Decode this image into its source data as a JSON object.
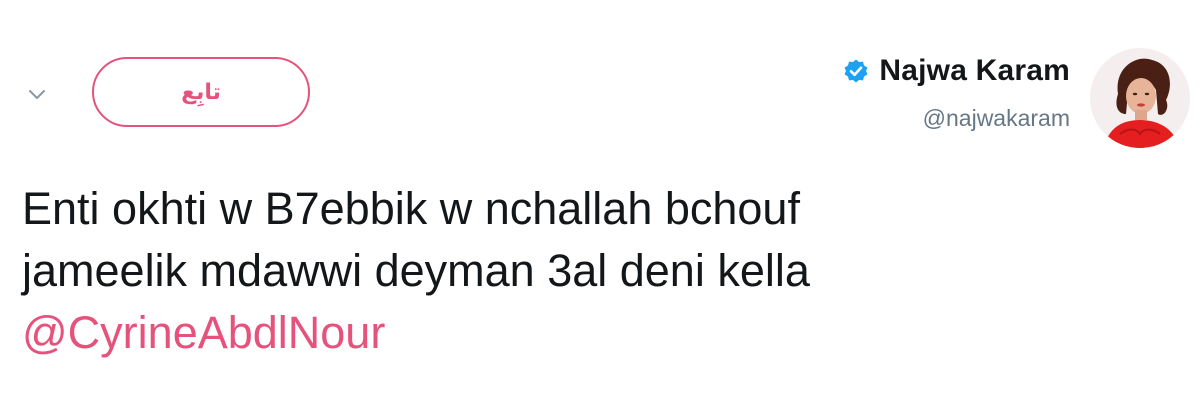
{
  "header": {
    "follow_label": "تابِع",
    "display_name": "Najwa Karam",
    "handle": "@najwakaram",
    "verified": true,
    "more_icon": "chevron-down-icon",
    "verified_icon": "verified-badge-icon"
  },
  "tweet": {
    "line1": "Enti okhti w B7ebbik w nchallah bchouf",
    "line2": "jameelik mdawwi deyman 3al deni kella",
    "mention": "@CyrineAbdlNour"
  },
  "colors": {
    "accent": "#e5537d",
    "verified": "#1da1f2",
    "text": "#14171a",
    "muted": "#657786"
  }
}
